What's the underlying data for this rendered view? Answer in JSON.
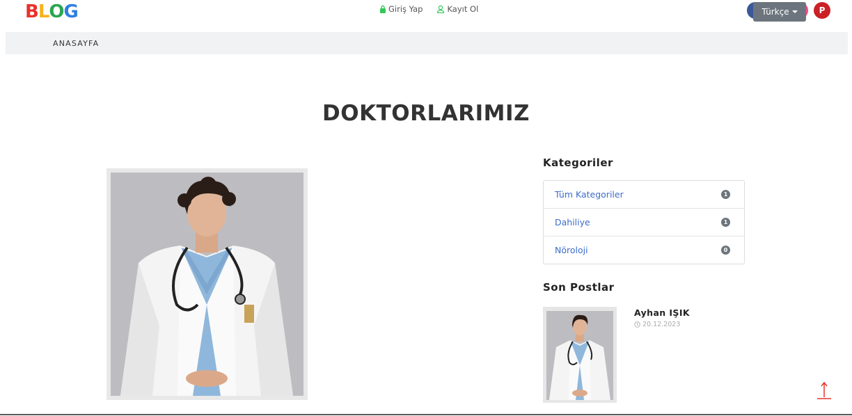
{
  "header": {
    "logo": {
      "letters": [
        "B",
        "L",
        "O",
        "G"
      ],
      "colors": [
        "#e8322b",
        "#f6b21a",
        "#2aa650",
        "#2f7fe0"
      ]
    },
    "auth": {
      "login": "Giriş Yap",
      "register": "Kayıt Ol",
      "login_icon": "lock-icon",
      "register_icon": "user-icon",
      "accent": "#34c759"
    },
    "social": [
      {
        "name": "facebook-icon",
        "color": "#3b5998",
        "glyph": "f"
      },
      {
        "name": "twitter-icon",
        "color": "#2d9cf0",
        "glyph": "🐦"
      },
      {
        "name": "dribbble-icon",
        "color": "#ea4c89",
        "glyph": "◎"
      },
      {
        "name": "pinterest-icon",
        "color": "#cb2027",
        "glyph": "P"
      }
    ]
  },
  "nav": {
    "home": "ANASAYFA",
    "language": "Türkçe"
  },
  "main": {
    "title": "DOKTORLARIMIZ"
  },
  "sidebar": {
    "categories_title": "Kategoriler",
    "categories": [
      {
        "label": "Tüm Kategoriler",
        "count": "1"
      },
      {
        "label": "Dahiliye",
        "count": "1"
      },
      {
        "label": "Nöroloji",
        "count": "0"
      }
    ],
    "recent_title": "Son Postlar",
    "recent_post": {
      "author": "Ayhan IŞIK",
      "date": "20.12.2023"
    }
  }
}
